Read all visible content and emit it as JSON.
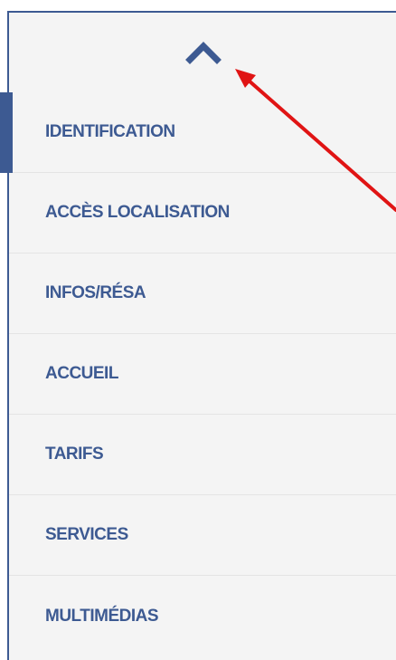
{
  "colors": {
    "accent": "#3d5a92",
    "panel_bg": "#f4f4f4",
    "divider": "#e4e4e4",
    "annotation": "#e01414"
  },
  "collapse_button": {
    "icon": "chevron-up-icon"
  },
  "menu": {
    "active_index": 0,
    "items": [
      {
        "label": "IDENTIFICATION"
      },
      {
        "label": "ACCÈS LOCALISATION"
      },
      {
        "label": "INFOS/RÉSA"
      },
      {
        "label": "ACCUEIL"
      },
      {
        "label": "TARIFS"
      },
      {
        "label": "SERVICES"
      },
      {
        "label": "MULTIMÉDIAS"
      }
    ]
  },
  "annotation": {
    "icon": "red-arrow-icon"
  }
}
